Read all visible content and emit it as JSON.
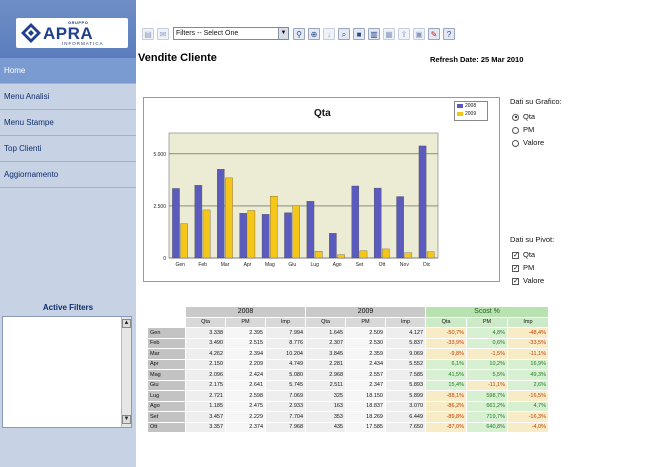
{
  "sidebar": {
    "logo": {
      "group": "GRUPPO",
      "name": "APRA",
      "sub": "INFORMATICA"
    },
    "items": [
      {
        "label": "Home",
        "active": true
      },
      {
        "label": "Menu Analisi",
        "active": false
      },
      {
        "label": "Menu Stampe",
        "active": false
      },
      {
        "label": "Top Clienti",
        "active": false
      },
      {
        "label": "Aggiornamento",
        "active": false
      }
    ],
    "active_filters_title": "Active Filters"
  },
  "toolbar": {
    "filter_select_value": "Filters -- Select One"
  },
  "header": {
    "title": "Vendite Cliente",
    "refresh": "Refresh Date: 25 Mar 2010"
  },
  "chart_data": {
    "type": "bar",
    "title": "Qta",
    "categories": [
      "Gen",
      "Feb",
      "Mar",
      "Apr",
      "Mag",
      "Giu",
      "Lug",
      "Ago",
      "Set",
      "Ott",
      "Nov",
      "Dic"
    ],
    "series": [
      {
        "name": "2008",
        "color": "#5b5bbd",
        "values": [
          3338,
          3490,
          4262,
          2150,
          2096,
          2175,
          2721,
          1185,
          3457,
          3357,
          2950,
          5380
        ]
      },
      {
        "name": "2009",
        "color": "#f5c518",
        "values": [
          1645,
          2307,
          3845,
          2281,
          2968,
          2511,
          325,
          163,
          353,
          435,
          250,
          300
        ]
      }
    ],
    "ylim": [
      0,
      6000
    ],
    "yticks": [
      0,
      2500,
      5000
    ],
    "ytick_labels": [
      "0",
      "2.500",
      "5.000"
    ],
    "grid": true,
    "legend": "top-right"
  },
  "options": {
    "graph_title": "Dati su Grafico:",
    "graph_options": [
      {
        "label": "Qta",
        "selected": true
      },
      {
        "label": "PM",
        "selected": false
      },
      {
        "label": "Valore",
        "selected": false
      }
    ],
    "pivot_title": "Dati su Pivot:",
    "pivot_options": [
      {
        "label": "Qta",
        "checked": true
      },
      {
        "label": "PM",
        "checked": true
      },
      {
        "label": "Valore",
        "checked": true
      }
    ]
  },
  "table": {
    "groups": [
      "2008",
      "2009",
      "Scost %"
    ],
    "subheaders": [
      "Qta",
      "PM",
      "Imp"
    ],
    "rows": [
      {
        "m": "Gen",
        "a": [
          "3.338",
          "2.395",
          "7.994"
        ],
        "b": [
          "1.645",
          "2.509",
          "4.127"
        ],
        "c": [
          "-50,7%",
          "4,8%",
          "-48,4%"
        ]
      },
      {
        "m": "Feb",
        "a": [
          "3.490",
          "2.515",
          "8.776"
        ],
        "b": [
          "2.307",
          "2.530",
          "5.837"
        ],
        "c": [
          "-33,9%",
          "0,6%",
          "-33,5%"
        ]
      },
      {
        "m": "Mar",
        "a": [
          "4.262",
          "2.394",
          "10.204"
        ],
        "b": [
          "3.845",
          "2.359",
          "9.069"
        ],
        "c": [
          "-9,8%",
          "-1,5%",
          "-11,1%"
        ]
      },
      {
        "m": "Apr",
        "a": [
          "2.150",
          "2.209",
          "4.749"
        ],
        "b": [
          "2.281",
          "2.434",
          "5.552"
        ],
        "c": [
          "6,1%",
          "10,2%",
          "16,9%"
        ]
      },
      {
        "m": "Mag",
        "a": [
          "2.096",
          "2.424",
          "5.080"
        ],
        "b": [
          "2.968",
          "2.557",
          "7.585"
        ],
        "c": [
          "41,5%",
          "5,5%",
          "49,3%"
        ]
      },
      {
        "m": "Giu",
        "a": [
          "2.175",
          "2.641",
          "5.745"
        ],
        "b": [
          "2.511",
          "2.347",
          "5.893"
        ],
        "c": [
          "15,4%",
          "-11,1%",
          "2,6%"
        ]
      },
      {
        "m": "Lug",
        "a": [
          "2.721",
          "2.598",
          "7.069"
        ],
        "b": [
          "325",
          "18.150",
          "5.899"
        ],
        "c": [
          "-88,1%",
          "598,7%",
          "-16,5%"
        ]
      },
      {
        "m": "Ago",
        "a": [
          "1.185",
          "2.475",
          "2.933"
        ],
        "b": [
          "163",
          "18.837",
          "3.070"
        ],
        "c": [
          "-86,2%",
          "661,2%",
          "4,7%"
        ]
      },
      {
        "m": "Set",
        "a": [
          "3.457",
          "2.229",
          "7.704"
        ],
        "b": [
          "353",
          "18.269",
          "6.449"
        ],
        "c": [
          "-89,8%",
          "719,7%",
          "-16,3%"
        ]
      },
      {
        "m": "Ott",
        "a": [
          "3.357",
          "2.374",
          "7.968"
        ],
        "b": [
          "435",
          "17.585",
          "7.650"
        ],
        "c": [
          "-87,0%",
          "640,8%",
          "-4,0%"
        ]
      }
    ]
  }
}
